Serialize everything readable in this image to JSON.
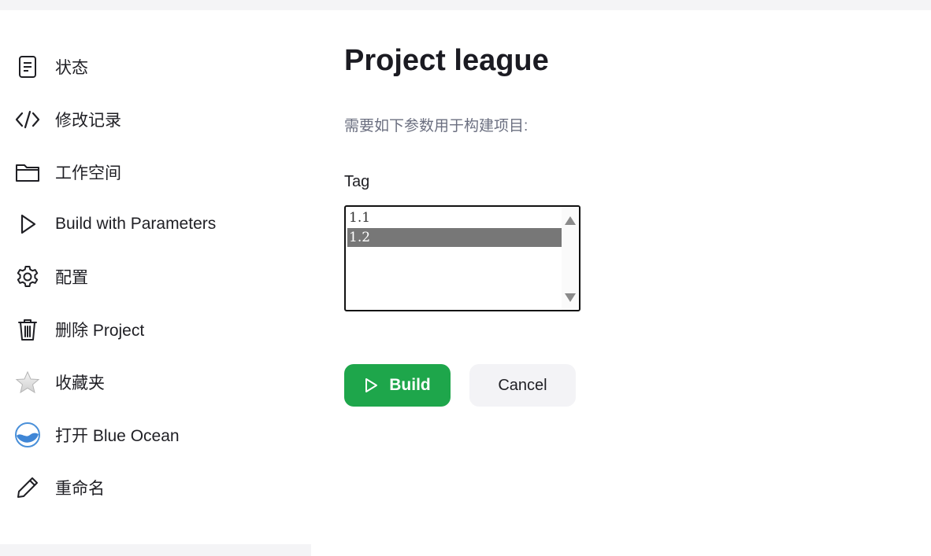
{
  "sidebar": {
    "items": [
      {
        "label": "状态",
        "icon": "status-document-icon"
      },
      {
        "label": "修改记录",
        "icon": "code-icon"
      },
      {
        "label": "工作空间",
        "icon": "folder-icon"
      },
      {
        "label": "Build with Parameters",
        "icon": "play-icon"
      },
      {
        "label": "配置",
        "icon": "gear-icon"
      },
      {
        "label": "删除 Project",
        "icon": "trash-icon"
      },
      {
        "label": "收藏夹",
        "icon": "star-icon"
      },
      {
        "label": "打开 Blue Ocean",
        "icon": "blue-ocean-icon"
      },
      {
        "label": "重命名",
        "icon": "pencil-icon"
      }
    ]
  },
  "main": {
    "title": "Project league",
    "description": "需要如下参数用于构建项目:",
    "parameter": {
      "label": "Tag",
      "options": [
        "1.1",
        "1.2"
      ],
      "selected": "1.2"
    },
    "build_label": "Build",
    "cancel_label": "Cancel"
  },
  "colors": {
    "build_button": "#1ea64b",
    "selected_option": "#777777",
    "cancel_button": "#f3f3f6"
  }
}
